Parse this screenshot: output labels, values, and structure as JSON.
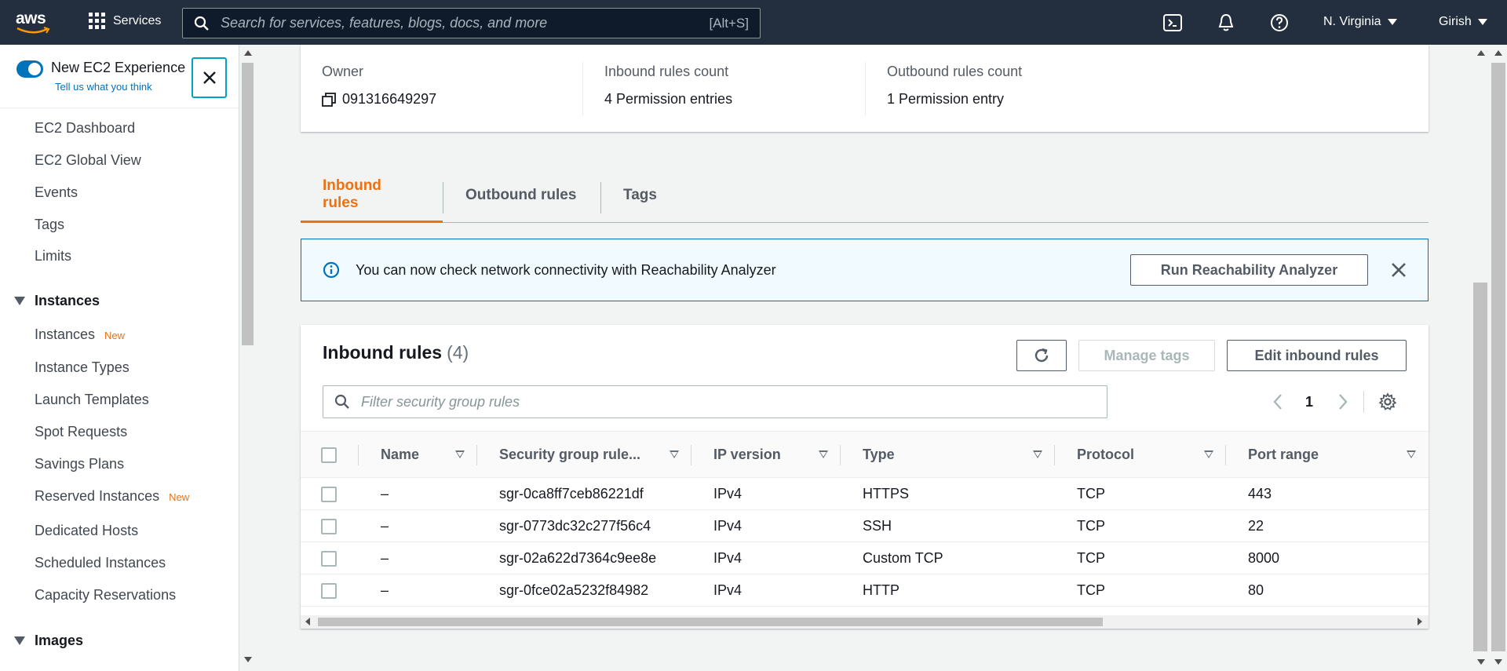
{
  "topnav": {
    "logo": "aws",
    "services_label": "Services",
    "search_placeholder": "Search for services, features, blogs, docs, and more",
    "search_shortcut": "[Alt+S]",
    "region": "N. Virginia",
    "user": "Girish",
    "icons": [
      "cloudshell-icon",
      "bell-icon",
      "help-icon"
    ]
  },
  "sidebar": {
    "experience_title": "New EC2 Experience",
    "experience_link": "Tell us what you think",
    "items_top": [
      "EC2 Dashboard",
      "EC2 Global View",
      "Events",
      "Tags",
      "Limits"
    ],
    "instances_section": "Instances",
    "instances_items": [
      {
        "label": "Instances",
        "badge": "New"
      },
      {
        "label": "Instance Types",
        "badge": ""
      },
      {
        "label": "Launch Templates",
        "badge": ""
      },
      {
        "label": "Spot Requests",
        "badge": ""
      },
      {
        "label": "Savings Plans",
        "badge": ""
      },
      {
        "label": "Reserved Instances",
        "badge": "New"
      },
      {
        "label": "Dedicated Hosts",
        "badge": ""
      },
      {
        "label": "Scheduled Instances",
        "badge": ""
      },
      {
        "label": "Capacity Reservations",
        "badge": ""
      }
    ],
    "images_section": "Images"
  },
  "details": {
    "owner_label": "Owner",
    "owner_value": "091316649297",
    "inbound_count_label": "Inbound rules count",
    "inbound_count_value": "4 Permission entries",
    "outbound_count_label": "Outbound rules count",
    "outbound_count_value": "1 Permission entry"
  },
  "tabs": [
    "Inbound rules",
    "Outbound rules",
    "Tags"
  ],
  "flash": {
    "message": "You can now check network connectivity with Reachability Analyzer",
    "button": "Run Reachability Analyzer"
  },
  "rules": {
    "title": "Inbound rules",
    "count": "(4)",
    "manage_tags": "Manage tags",
    "edit_button": "Edit inbound rules",
    "filter_placeholder": "Filter security group rules",
    "page": "1",
    "columns": [
      "Name",
      "Security group rule...",
      "IP version",
      "Type",
      "Protocol",
      "Port range"
    ],
    "rows": [
      [
        "–",
        "sgr-0ca8ff7ceb86221df",
        "IPv4",
        "HTTPS",
        "TCP",
        "443"
      ],
      [
        "–",
        "sgr-0773dc32c277f56c4",
        "IPv4",
        "SSH",
        "TCP",
        "22"
      ],
      [
        "–",
        "sgr-02a622d7364c9ee8e",
        "IPv4",
        "Custom TCP",
        "TCP",
        "8000"
      ],
      [
        "–",
        "sgr-0fce02a5232f84982",
        "IPv4",
        "HTTP",
        "TCP",
        "80"
      ]
    ]
  },
  "colors": {
    "nav_bg": "#232f3e",
    "accent_orange": "#ec7211",
    "link_blue": "#0073bb"
  }
}
